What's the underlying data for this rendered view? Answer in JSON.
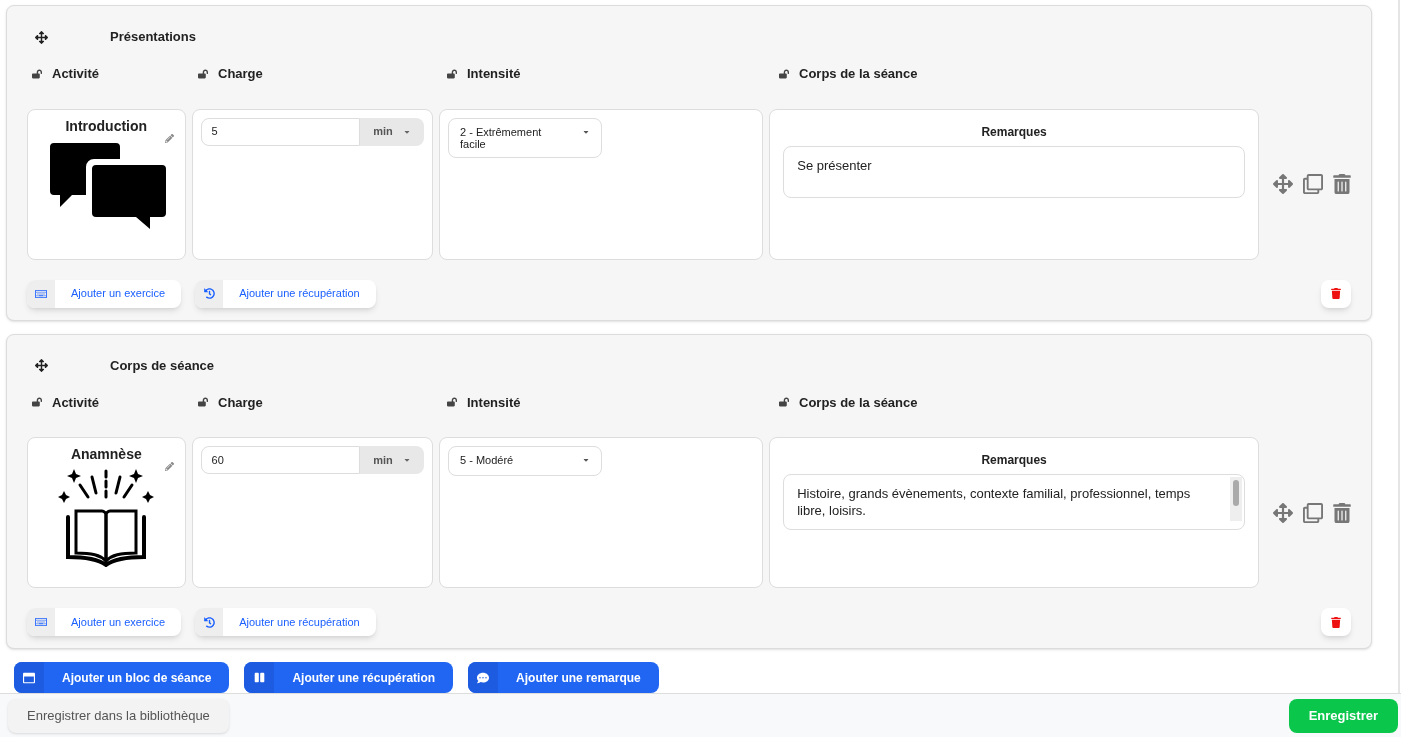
{
  "blocks": [
    {
      "title": "Présentations",
      "columns": [
        "Activité",
        "Charge",
        "Intensité",
        "Corps de la séance"
      ],
      "activity": {
        "name": "Introduction"
      },
      "charge": {
        "value": "5",
        "unit": "min"
      },
      "intensity": {
        "value": "2 - Extrêmement facile"
      },
      "remarks": {
        "label": "Remarques",
        "value": "Se présenter",
        "scrollbar": false
      },
      "buttons": [
        "Ajouter un exercice",
        "Ajouter une récupération"
      ]
    },
    {
      "title": "Corps de séance",
      "columns": [
        "Activité",
        "Charge",
        "Intensité",
        "Corps de la séance"
      ],
      "activity": {
        "name": "Anamnèse"
      },
      "charge": {
        "value": "60",
        "unit": "min"
      },
      "intensity": {
        "value": "5 - Modéré"
      },
      "remarks": {
        "label": "Remarques",
        "value": "Histoire, grands évènements, contexte familial, professionnel, temps libre, loisirs.",
        "scrollbar": true
      },
      "buttons": [
        "Ajouter un exercice",
        "Ajouter une récupération"
      ]
    }
  ],
  "add_buttons": [
    "Ajouter un bloc de séance",
    "Ajouter une récupération",
    "Ajouter une remarque"
  ],
  "footer": {
    "library_button": "Enregistrer dans la bibliothèque",
    "save_button": "Enregistrer"
  }
}
